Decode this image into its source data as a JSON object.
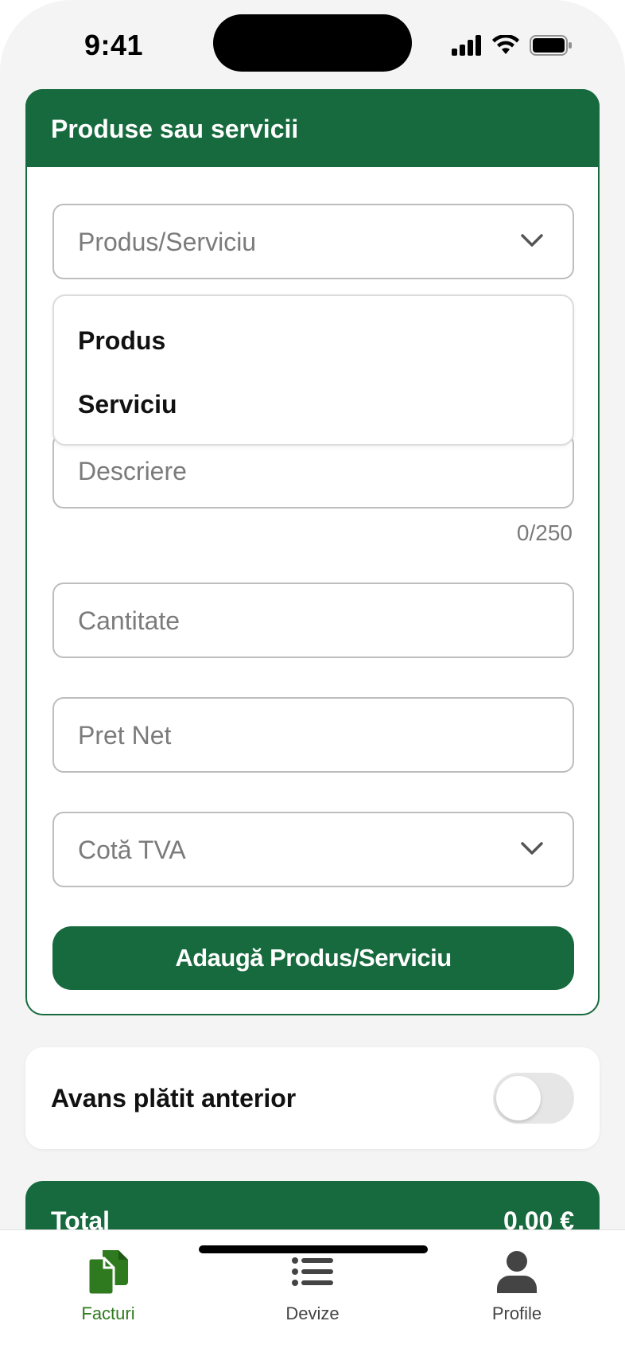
{
  "status_bar": {
    "time": "9:41"
  },
  "products_card": {
    "title": "Produse sau servicii",
    "type_select": {
      "placeholder": "Produs/Serviciu"
    },
    "type_options": [
      "Produs",
      "Serviciu"
    ],
    "description": {
      "placeholder": "Descriere",
      "counter": "0/250"
    },
    "quantity": {
      "placeholder": "Cantitate"
    },
    "net_price": {
      "placeholder": "Pret Net"
    },
    "vat_select": {
      "placeholder": "Cotă TVA"
    },
    "add_button": "Adaugă Produs/Serviciu"
  },
  "advance_card": {
    "label": "Avans plătit anterior",
    "toggle_on": false
  },
  "total_card": {
    "label": "Total",
    "value": "0.00 €"
  },
  "tab_bar": {
    "items": [
      {
        "label": "Facturi",
        "icon": "documents-icon",
        "active": true
      },
      {
        "label": "Devize",
        "icon": "list-icon",
        "active": false
      },
      {
        "label": "Profile",
        "icon": "person-icon",
        "active": false
      }
    ]
  },
  "colors": {
    "primary": "#176a3e",
    "active_tab": "#2f7a1f"
  }
}
